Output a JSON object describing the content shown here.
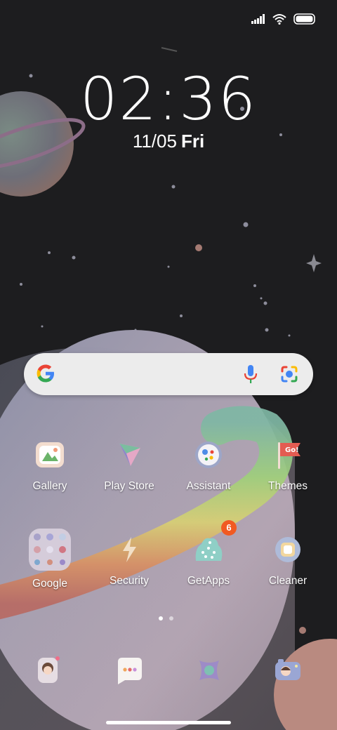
{
  "status": {
    "signal_icon": "signal-icon",
    "wifi_icon": "wifi-icon",
    "battery_icon": "battery-icon"
  },
  "lock": {
    "hours": "02",
    "separator": ":",
    "minutes": "36",
    "date": "11/05",
    "weekday": "Fri"
  },
  "search_bar": {
    "logo_icon": "google-g-icon",
    "mic_icon": "mic-icon",
    "lens_icon": "lens-icon"
  },
  "apps_row1": [
    {
      "label": "Gallery",
      "icon": "gallery-icon"
    },
    {
      "label": "Play Store",
      "icon": "play-store-icon"
    },
    {
      "label": "Assistant",
      "icon": "assistant-icon"
    },
    {
      "label": "Themes",
      "icon": "themes-icon"
    }
  ],
  "apps_row2": [
    {
      "label": "Google",
      "icon": "google-folder-icon"
    },
    {
      "label": "Security",
      "icon": "security-icon"
    },
    {
      "label": "GetApps",
      "icon": "getapps-icon",
      "badge": "6"
    },
    {
      "label": "Cleaner",
      "icon": "cleaner-icon"
    }
  ],
  "page_indicator": {
    "pages": 2,
    "current": 1
  },
  "dock": [
    {
      "icon": "phone-icon"
    },
    {
      "icon": "messages-icon"
    },
    {
      "icon": "browser-icon"
    },
    {
      "icon": "camera-icon"
    }
  ],
  "colors": {
    "background": "#1d1d1f",
    "badge": "#f15a22",
    "search_bg": "#ececec"
  }
}
